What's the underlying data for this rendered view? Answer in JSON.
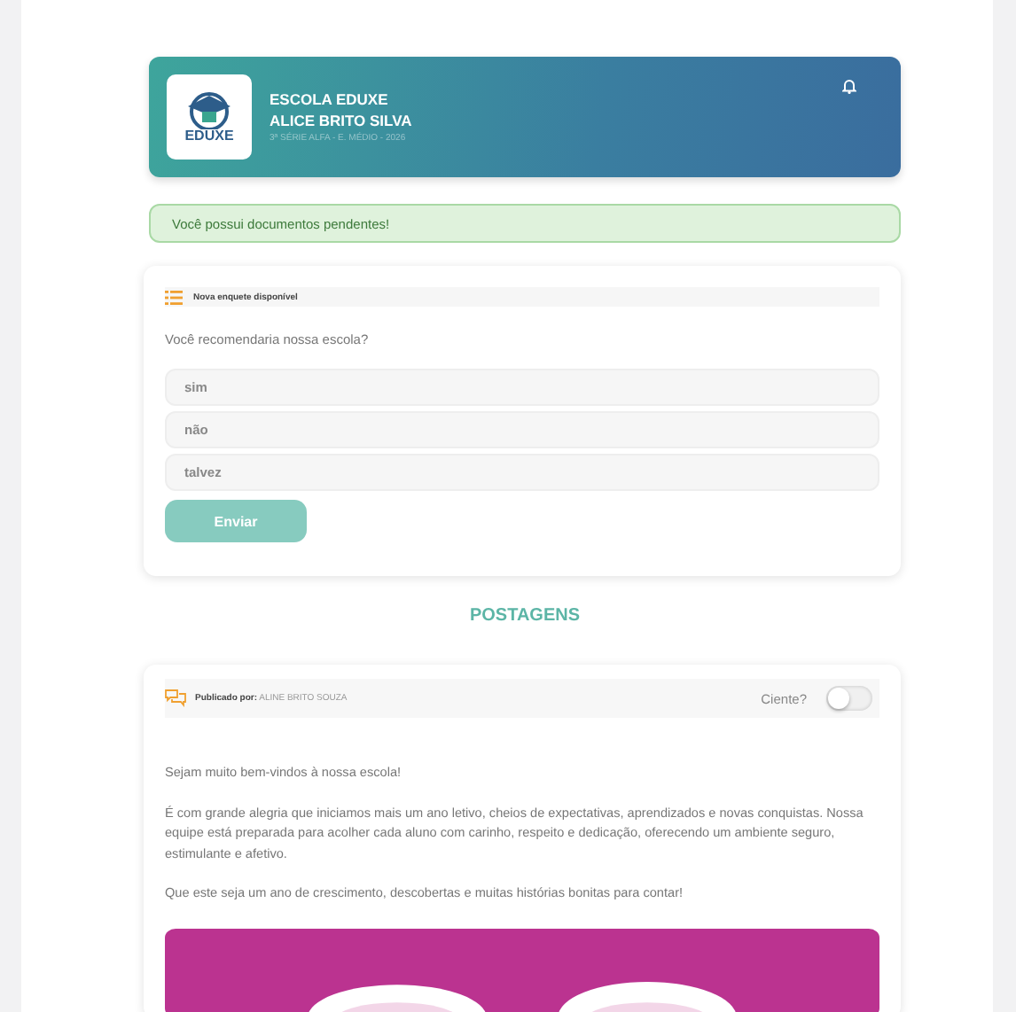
{
  "header": {
    "school": "ESCOLA EDUXE",
    "student": "ALICE BRITO SILVA",
    "class_info": "3ª SÉRIE ALFA - E. MÉDIO - 2026",
    "logo_text": "EDUXE"
  },
  "alert": {
    "text": "Você possui documentos pendentes!"
  },
  "poll": {
    "title": "Nova enquete disponível",
    "question": "Você recomendaria nossa escola?",
    "options": [
      {
        "label": "sim",
        "selected": false
      },
      {
        "label": "não",
        "selected": false
      },
      {
        "label": "talvez",
        "selected": false
      }
    ],
    "submit": "Enviar"
  },
  "section_title": "POSTAGENS",
  "post": {
    "author_label": "Publicado por:",
    "author": "ALINE BRITO SOUZA",
    "ack_label": "Ciente?",
    "ack_checked": false,
    "paragraphs": [
      "Sejam muito bem-vindos à nossa escola!",
      "É com grande alegria que iniciamos mais um ano letivo, cheios de expectativas, aprendizados e novas conquistas. Nossa equipe está preparada para acolher cada aluno com carinho, respeito e dedicação, oferecendo um ambiente seguro, estimulante e afetivo.",
      "Que este seja um ano de crescimento, descobertas e muitas histórias bonitas para contar!"
    ]
  }
}
